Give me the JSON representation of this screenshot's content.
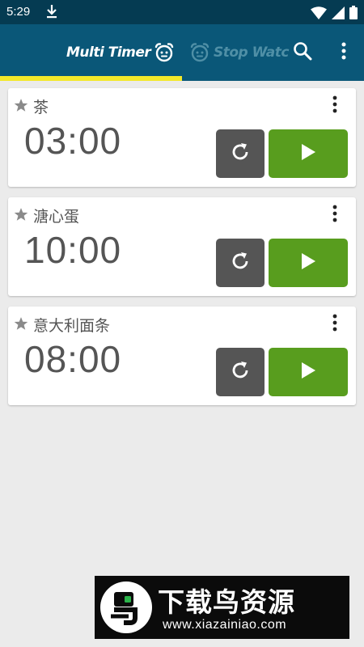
{
  "status_bar": {
    "time": "5:29",
    "icons": [
      "download-icon",
      "wifi-icon",
      "signal-icon",
      "battery-icon"
    ]
  },
  "app_bar": {
    "tabs": [
      {
        "label": "Multi Timer",
        "icon": "alarm-clock-icon",
        "selected": true
      },
      {
        "label": "Stop Watc",
        "icon": "alarm-clock-icon",
        "selected": false
      }
    ],
    "actions": [
      "search-icon",
      "more-vert-icon"
    ],
    "colors": {
      "status_bar": "#053b52",
      "app_bar": "#0a5778",
      "tab_indicator": "#f3e82a",
      "inactive_tab": "#4f8fa6"
    }
  },
  "timers": [
    {
      "name": "茶",
      "time": "03:00"
    },
    {
      "name": "溏心蛋",
      "time": "10:00"
    },
    {
      "name": "意大利面条",
      "time": "08:00"
    }
  ],
  "timer_card": {
    "icons": [
      "star-icon",
      "more-vert-icon",
      "reset-icon",
      "play-icon"
    ],
    "colors": {
      "reset_button": "#555555",
      "play_button": "#589d1e"
    }
  },
  "watermark": {
    "title": "下载鸟资源",
    "url": "www.xiazainiao.com"
  }
}
